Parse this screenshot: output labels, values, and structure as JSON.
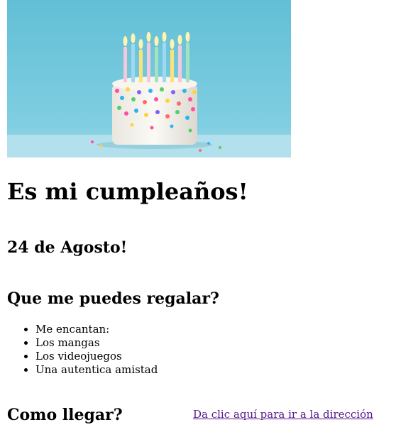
{
  "hero": {
    "image_icon": "birthday-cake-image",
    "background_color": "#7fcde0",
    "candle_count": 9
  },
  "title": "Es mi cumpleaños!",
  "date": "24 de Agosto!",
  "gifts": {
    "heading": "Que me puedes regalar?",
    "items": [
      "Me encantan:",
      "Los mangas",
      "Los videojuegos",
      "Una autentica amistad"
    ]
  },
  "directions": {
    "heading": "Como llegar?",
    "link_text": "Da clic aquí para ir a la dirección",
    "link_color": "#551a8b"
  }
}
